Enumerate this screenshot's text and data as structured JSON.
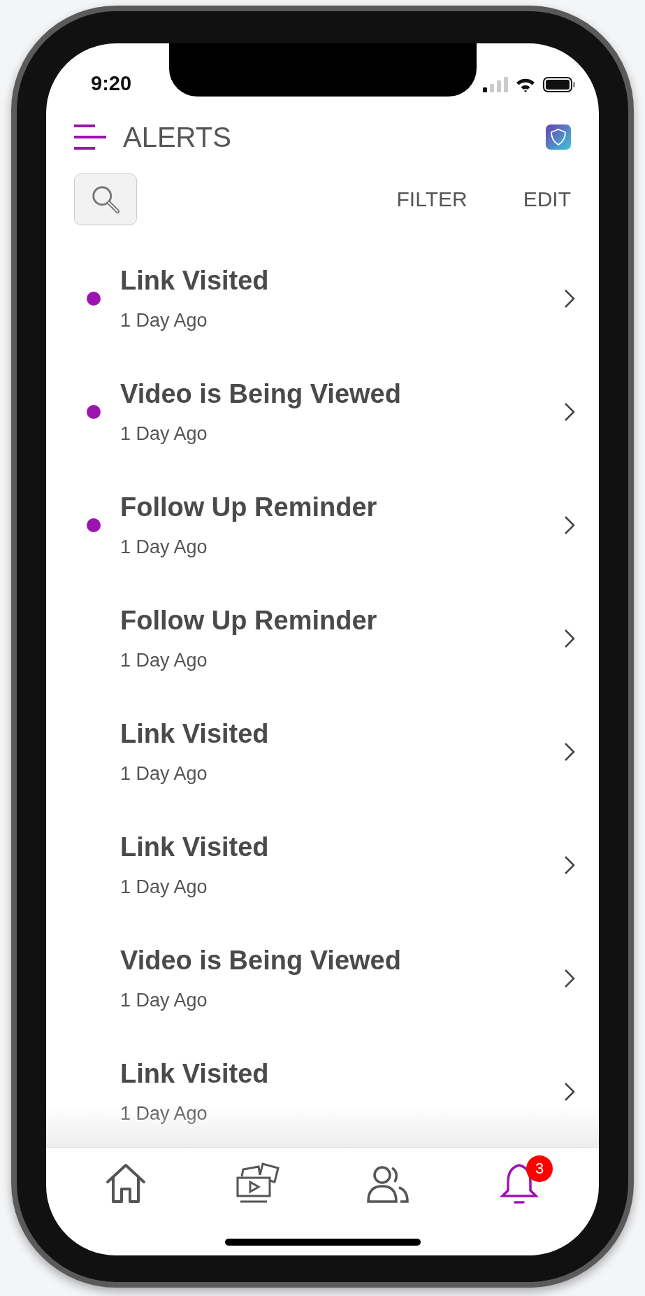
{
  "status_bar": {
    "time": "9:20"
  },
  "header": {
    "title": "ALERTS"
  },
  "toolbar": {
    "actions": [
      "FILTER",
      "EDIT"
    ]
  },
  "alerts": [
    {
      "title": "Link Visited",
      "time": "1 Day Ago",
      "unread": true
    },
    {
      "title": "Video is Being Viewed",
      "time": "1 Day Ago",
      "unread": true
    },
    {
      "title": "Follow Up Reminder",
      "time": "1 Day Ago",
      "unread": true
    },
    {
      "title": "Follow Up Reminder",
      "time": "1 Day Ago",
      "unread": false
    },
    {
      "title": "Link Visited",
      "time": "1 Day Ago",
      "unread": false
    },
    {
      "title": "Link Visited",
      "time": "1 Day Ago",
      "unread": false
    },
    {
      "title": "Video is Being Viewed",
      "time": "1 Day Ago",
      "unread": false
    },
    {
      "title": "Link Visited",
      "time": "1 Day Ago",
      "unread": false
    }
  ],
  "tab_bar": [
    {
      "kind": "home",
      "selected": false
    },
    {
      "kind": "media",
      "selected": false
    },
    {
      "kind": "contacts",
      "selected": false
    },
    {
      "kind": "alerts",
      "selected": true,
      "badge": "3"
    }
  ]
}
